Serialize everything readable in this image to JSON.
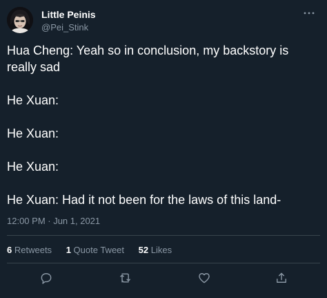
{
  "author": {
    "display_name": "Little Peinis",
    "handle": "@Pei_Stink"
  },
  "tweet": {
    "lines": [
      "Hua Cheng: Yeah so in conclusion, my backstory is",
      "really sad",
      "",
      "He Xuan:",
      "",
      "He Xuan:",
      "",
      "He Xuan:",
      "",
      "He Xuan: Had it not been for the laws of this land-"
    ],
    "timestamp": "12:00 PM · Jun 1, 2021"
  },
  "stats": {
    "retweets_count": "6",
    "retweets_label": "Retweets",
    "quotes_count": "1",
    "quotes_label": "Quote Tweet",
    "likes_count": "52",
    "likes_label": "Likes"
  },
  "actions": {
    "reply_icon": "reply-icon",
    "retweet_icon": "retweet-icon",
    "like_icon": "heart-icon",
    "share_icon": "share-icon"
  },
  "colors": {
    "background": "#15202b",
    "text": "#ffffff",
    "secondary_text": "#8b98a5",
    "divider": "#38444d"
  }
}
